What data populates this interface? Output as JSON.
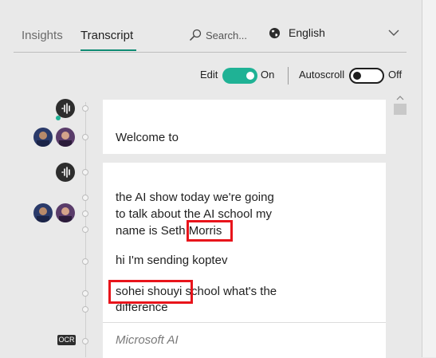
{
  "tabs": [
    {
      "label": "Insights",
      "active": false
    },
    {
      "label": "Transcript",
      "active": true
    }
  ],
  "search": {
    "placeholder": "Search..."
  },
  "language": {
    "selected": "English"
  },
  "toggles": {
    "edit_label": "Edit",
    "edit_state": "On",
    "autoscroll_label": "Autoscroll",
    "autoscroll_state": "Off"
  },
  "transcript": {
    "blocks": [
      {
        "lines": [
          "Welcome to"
        ]
      },
      {
        "lines": [
          "the AI show today we're going",
          "to talk about the AI school my",
          "name is Seth Morris",
          "hi I'm sending koptev",
          "sohei shouyi school what's the",
          "difference"
        ]
      }
    ],
    "highlighted_words": [
      "Morris",
      "sohei shouyi"
    ]
  },
  "ocr": {
    "badge": "OCR",
    "text": "Microsoft AI"
  },
  "colors": {
    "accent": "#1fb295",
    "tab_underline": "#0f8c74",
    "highlight_box": "#e8141b",
    "background": "#e9e9e9"
  },
  "icons": {
    "search": "search-icon",
    "globe": "globe-icon",
    "chevron": "chevron-down-icon",
    "audio": "audio-wave-icon"
  }
}
